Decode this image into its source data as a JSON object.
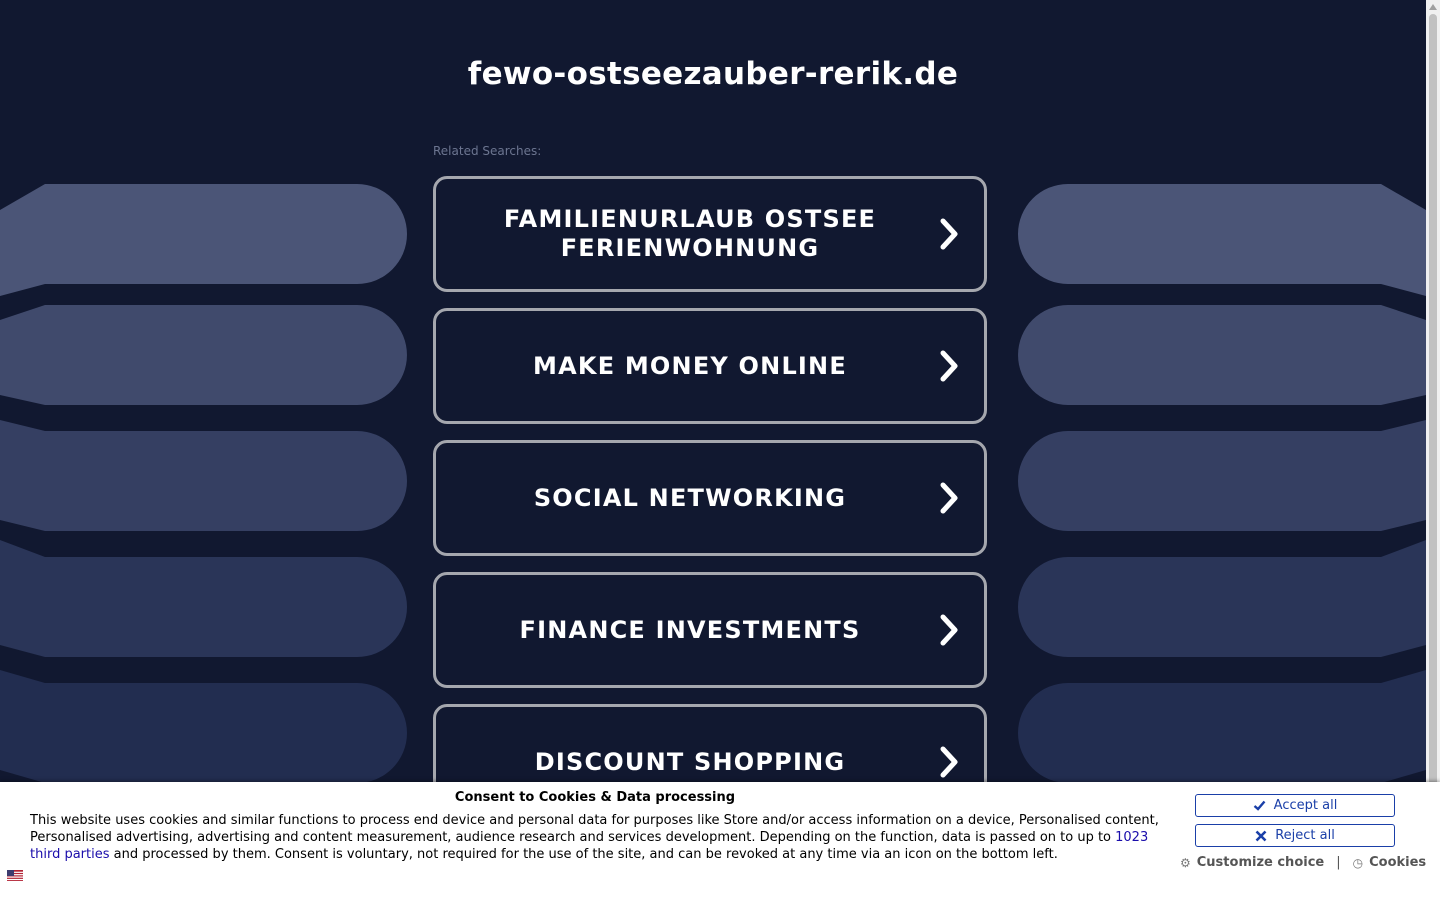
{
  "site": {
    "title": "fewo-ostseezauber-rerik.de"
  },
  "related": {
    "label": "Related Searches:",
    "items": [
      {
        "label": "FAMILIENURLAUB OSTSEE FERIENWOHNUNG"
      },
      {
        "label": "MAKE MONEY ONLINE"
      },
      {
        "label": "SOCIAL NETWORKING"
      },
      {
        "label": "FINANCE INVESTMENTS"
      },
      {
        "label": "DISCOUNT SHOPPING"
      }
    ]
  },
  "consent": {
    "title": "Consent to Cookies & Data processing",
    "text_before": "This website uses cookies and similar functions to process end device and personal data for purposes like Store and/or access information on a device, Personalised content, Personalised advertising, advertising and content measurement, audience research and services development. Depending on the function, data is passed on to up to ",
    "link": "1023 third parties",
    "text_after": " and processed by them. Consent is voluntary, not required for the use of the site, and can be revoked at any time via an icon on the bottom left.",
    "accept": "Accept all",
    "reject": "Reject all",
    "customize": "Customize choice",
    "cookies": "Cookies",
    "separator": "|"
  },
  "colors": {
    "background": "#111830",
    "pill_light": "#4b5577",
    "pill_dark": "#1f2b4c",
    "accent_blue": "#1a3fa8"
  },
  "icons": [
    "chevron-right-icon",
    "check-icon",
    "close-icon",
    "gear-icon",
    "cookie-icon",
    "flag-icon"
  ]
}
